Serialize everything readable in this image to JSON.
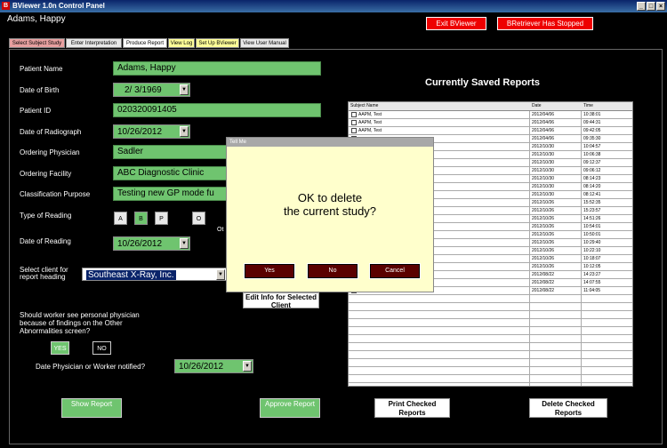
{
  "window": {
    "title": "BViewer 1.0n Control Panel",
    "icon": "B"
  },
  "user_name": "Adams, Happy",
  "header_buttons": {
    "exit": "Exit BViewer",
    "stopped": "BRetriever Has Stopped"
  },
  "tabs": [
    {
      "label": "Select Subject Study",
      "color": "#e8a0a0"
    },
    {
      "label": "Enter Interpretation",
      "color": "#e8e8e8"
    },
    {
      "label": "Produce Report",
      "color": "#ffffff"
    },
    {
      "label": "View Log",
      "color": "#ffff99"
    },
    {
      "label": "Set Up BViewer",
      "color": "#ffff99"
    },
    {
      "label": "View User Manual",
      "color": "#e8e8e8"
    }
  ],
  "form": {
    "patient_name_label": "Patient Name",
    "patient_name": "Adams, Happy",
    "dob_label": "Date of Birth",
    "dob": "2/ 3/1969",
    "patient_id_label": "Patient ID",
    "patient_id": "020320091405",
    "radiograph_label": "Date of Radiograph",
    "radiograph_date": "10/26/2012",
    "physician_label": "Ordering Physician",
    "physician": "Sadler",
    "facility_label": "Ordering Facility",
    "facility": "ABC Diagnostic Clinic",
    "purpose_label": "Classification Purpose",
    "purpose": "Testing new GP mode fu",
    "reading_type_label": "Type of Reading",
    "reading_type_a": "A",
    "reading_type_b": "B",
    "reading_type_p": "P",
    "reading_type_o": "O",
    "reading_other_label": "Ot",
    "reading_date_label": "Date of Reading",
    "reading_date": "10/26/2012",
    "client_label": "Select client for report heading",
    "client": "Southeast X-Ray, Inc.",
    "edit_client": "Edit Info for Selected Client",
    "worker_question": "Should worker see personal physician because of findings on the Other Abnormalities screen?",
    "yes": "YES",
    "no": "NO",
    "notified_label": "Date Physician or Worker notified?",
    "notified_date": "10/26/2012"
  },
  "bottom_buttons": {
    "show_report": "Show Report",
    "approve_report": "Approve Report",
    "print_checked": "Print Checked Reports",
    "delete_checked": "Delete Checked Reports"
  },
  "reports": {
    "title": "Currently Saved Reports",
    "columns": [
      "Subject Name",
      "Date",
      "Time"
    ],
    "rows": [
      [
        "AAPM, Test",
        "2012/04/06",
        "10:38:01"
      ],
      [
        "AAPM, Test",
        "2012/04/06",
        "09:44:31"
      ],
      [
        "AAPM, Test",
        "2012/04/06",
        "09:42:05"
      ],
      [
        "",
        "2012/04/06",
        "09:35:30"
      ],
      [
        "",
        "2012/10/30",
        "10:04:57"
      ],
      [
        "",
        "2012/10/30",
        "10:06:38"
      ],
      [
        "",
        "2012/10/30",
        "09:12:37"
      ],
      [
        "",
        "2012/10/30",
        "09:06:12"
      ],
      [
        "",
        "2012/10/30",
        "08:14:23"
      ],
      [
        "",
        "2012/10/30",
        "08:14:20"
      ],
      [
        "",
        "2012/10/30",
        "08:12:41"
      ],
      [
        "",
        "2012/10/26",
        "15:52:35"
      ],
      [
        "",
        "2012/10/26",
        "15:23:57"
      ],
      [
        "",
        "2012/10/26",
        "14:51:26"
      ],
      [
        "",
        "2012/10/26",
        "10:54:01"
      ],
      [
        "",
        "2012/10/26",
        "10:50:01"
      ],
      [
        "",
        "2012/10/26",
        "10:29:40"
      ],
      [
        "",
        "2012/10/26",
        "10:22:10"
      ],
      [
        "",
        "2012/10/26",
        "10:18:07"
      ],
      [
        "",
        "2012/10/26",
        "10:12:05"
      ],
      [
        "Cooper, Many_",
        "2012/08/22",
        "14:23:27"
      ],
      [
        "Cooper, Many_",
        "2012/08/22",
        "14:07:55"
      ],
      [
        "Cooper, Many_",
        "2012/08/22",
        "11:04:05"
      ]
    ]
  },
  "dialog": {
    "title": "Tell Me",
    "message_line1": "OK to delete",
    "message_line2": "the current study?",
    "yes": "Yes",
    "no": "No",
    "cancel": "Cancel"
  }
}
